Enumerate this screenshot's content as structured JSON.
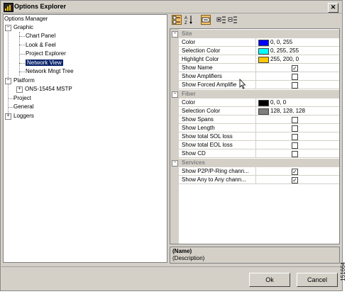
{
  "window": {
    "title": "Options Explorer"
  },
  "tree": {
    "root": "Options Manager",
    "graphic": "Graphic",
    "chart_panel": "Chart Panel",
    "look_feel": "Look & Feel",
    "project_explorer": "Project Explorer",
    "network_view": "Network View",
    "network_mngt_tree": "Network Mngt Tree",
    "platform": "Platform",
    "ons": "ONS-15454 MSTP",
    "project": "Project",
    "general": "General",
    "loggers": "Loggers"
  },
  "properties": {
    "site": {
      "label": "Site",
      "color": {
        "name": "Color",
        "value": "0, 0, 255",
        "swatch": "#0000ff"
      },
      "selection_color": {
        "name": "Selection Color",
        "value": "0, 255, 255",
        "swatch": "#00ffff"
      },
      "highlight_color": {
        "name": "Highlight Color",
        "value": "255, 200, 0",
        "swatch": "#ffc800"
      },
      "show_name": {
        "name": "Show Name",
        "checked": true
      },
      "show_amplifiers": {
        "name": "Show Amplifiers",
        "checked": false
      },
      "show_forced_amplifiers": {
        "name": "Show Forced Amplifie",
        "checked": false
      }
    },
    "fiber": {
      "label": "Fiber",
      "color": {
        "name": "Color",
        "value": "0, 0, 0",
        "swatch": "#000000"
      },
      "selection_color": {
        "name": "Selection Color",
        "value": "128, 128, 128",
        "swatch": "#808080"
      },
      "show_spans": {
        "name": "Show Spans",
        "checked": false
      },
      "show_length": {
        "name": "Show Length",
        "checked": false
      },
      "show_total_sol_loss": {
        "name": "Show total SOL loss",
        "checked": false
      },
      "show_total_eol_loss": {
        "name": "Show total EOL loss",
        "checked": false
      },
      "show_cd": {
        "name": "Show CD",
        "checked": false
      }
    },
    "services": {
      "label": "Services",
      "show_p2p": {
        "name": "Show P2P/P-Ring chann...",
        "checked": true
      },
      "show_any": {
        "name": "Show Any to Any chann...",
        "checked": true
      }
    }
  },
  "description": {
    "name": "(Name)",
    "text": "(Description)"
  },
  "buttons": {
    "ok": "Ok",
    "cancel": "Cancel"
  },
  "figure_id": "151664",
  "check_mark": "✓"
}
